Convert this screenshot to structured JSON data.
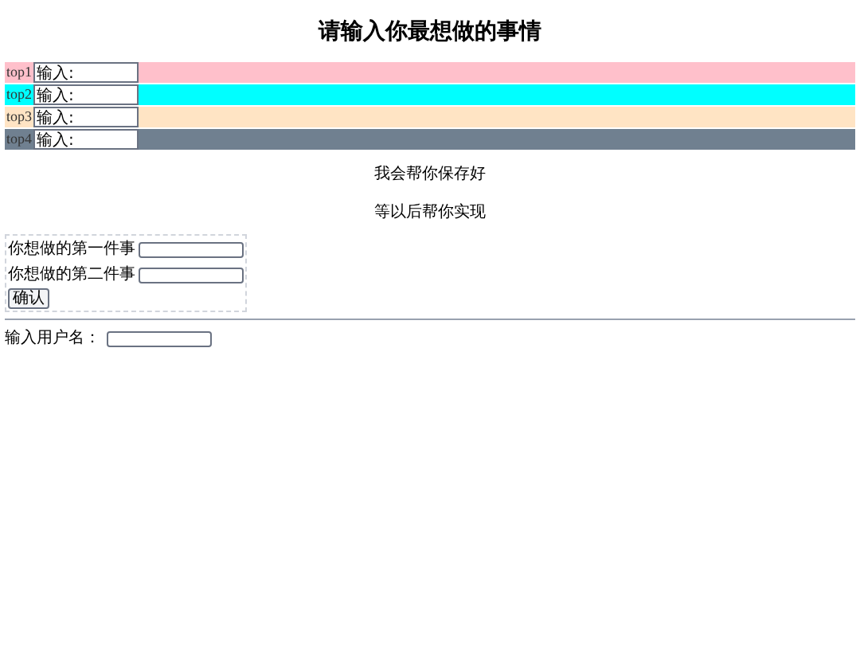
{
  "title": "请输入你最想做的事情",
  "rows": [
    {
      "label": "top1",
      "value": "输入:",
      "color": "#ffc0cb"
    },
    {
      "label": "top2",
      "value": "输入:",
      "color": "#00ffff"
    },
    {
      "label": "top3",
      "value": "输入:",
      "color": "#ffe4c4"
    },
    {
      "label": "top4",
      "value": "输入:",
      "color": "#708090"
    }
  ],
  "messages": [
    "我会帮你保存好",
    "等以后帮你实现"
  ],
  "form": {
    "fields": [
      {
        "label": "你想做的第一件事"
      },
      {
        "label": "你想做的第二件事"
      }
    ],
    "button": "确认"
  },
  "username": {
    "label": "输入用户名："
  }
}
